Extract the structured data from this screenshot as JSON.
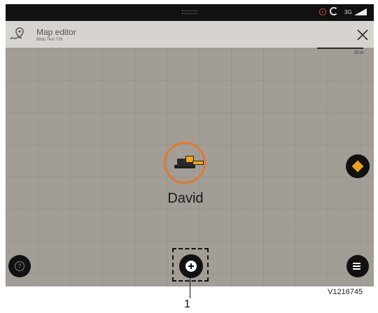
{
  "header": {
    "title": "Map editor",
    "subtitle": "Bildu Test 726"
  },
  "map": {
    "scale_label": "20 m"
  },
  "machine": {
    "name": "David"
  },
  "status_bar": {
    "network": "3G"
  },
  "icons": {
    "app": "map-pin-icon",
    "close": "close-icon",
    "locate": "locate-icon",
    "help": "help-icon",
    "add": "add-icon",
    "menu": "menu-icon"
  },
  "colors": {
    "accent": "#e07a2e",
    "machine": "#f0a81a",
    "buttons": "#111111"
  },
  "figure": {
    "callout": "1",
    "reference": "V1216745"
  }
}
